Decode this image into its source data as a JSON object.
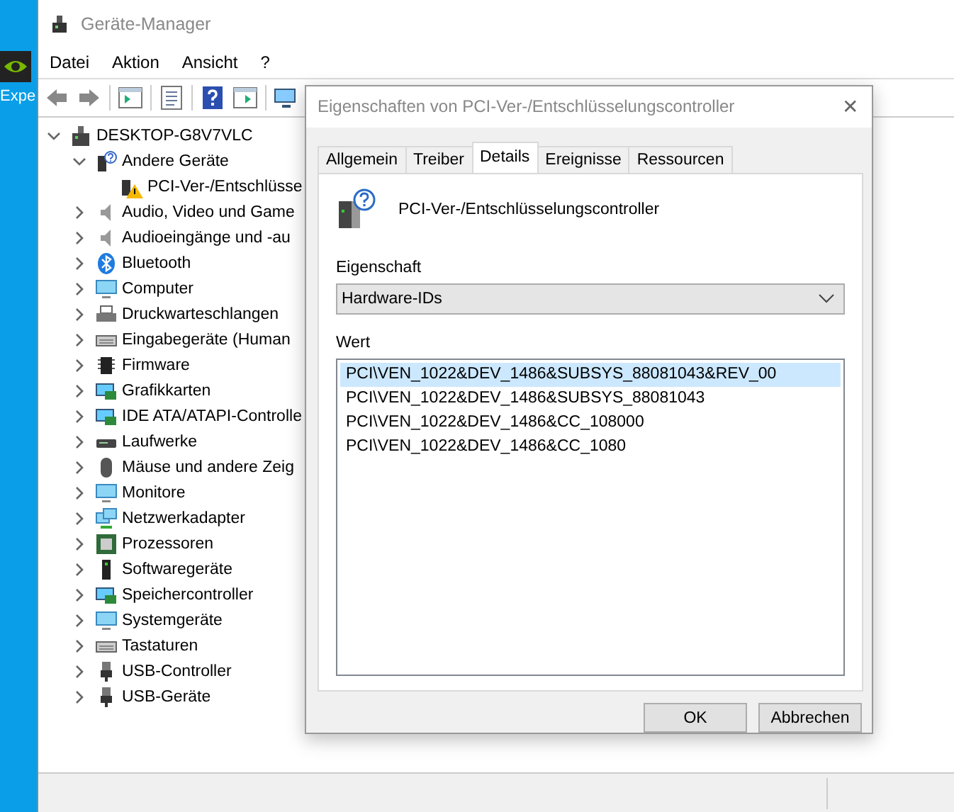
{
  "desktop": {
    "shortcut_label": "Expe"
  },
  "window": {
    "title": "Geräte-Manager"
  },
  "menu": [
    "Datei",
    "Aktion",
    "Ansicht",
    "?"
  ],
  "toolbar": [
    {
      "kind": "back"
    },
    {
      "kind": "forward"
    },
    {
      "kind": "sep"
    },
    {
      "kind": "tree"
    },
    {
      "kind": "sep"
    },
    {
      "kind": "properties"
    },
    {
      "kind": "sep"
    },
    {
      "kind": "help"
    },
    {
      "kind": "pane"
    },
    {
      "kind": "sep"
    },
    {
      "kind": "scan"
    }
  ],
  "tree": {
    "label": "DESKTOP-G8V7VLC",
    "kind": "computer",
    "expanded": true,
    "children": [
      {
        "label": "Andere Geräte",
        "kind": "unknown",
        "expanded": true,
        "children": [
          {
            "label": "PCI-Ver-/Entschlüsse",
            "kind": "warning"
          }
        ]
      },
      {
        "label": "Audio, Video und Game",
        "kind": "speaker",
        "expanded": false
      },
      {
        "label": "Audioeingänge und -au",
        "kind": "speaker",
        "expanded": false
      },
      {
        "label": "Bluetooth",
        "kind": "bluetooth",
        "expanded": false
      },
      {
        "label": "Computer",
        "kind": "monitor",
        "expanded": false
      },
      {
        "label": "Druckwarteschlangen",
        "kind": "printer",
        "expanded": false
      },
      {
        "label": "Eingabegeräte (Human",
        "kind": "keyboard",
        "expanded": false
      },
      {
        "label": "Firmware",
        "kind": "chip",
        "expanded": false
      },
      {
        "label": "Grafikkarten",
        "kind": "card",
        "expanded": false
      },
      {
        "label": "IDE ATA/ATAPI-Controlle",
        "kind": "card",
        "expanded": false
      },
      {
        "label": "Laufwerke",
        "kind": "drive",
        "expanded": false
      },
      {
        "label": "Mäuse und andere Zeig",
        "kind": "mouse",
        "expanded": false
      },
      {
        "label": "Monitore",
        "kind": "monitor",
        "expanded": false
      },
      {
        "label": "Netzwerkadapter",
        "kind": "network",
        "expanded": false
      },
      {
        "label": "Prozessoren",
        "kind": "cpu",
        "expanded": false
      },
      {
        "label": "Softwaregeräte",
        "kind": "tower",
        "expanded": false
      },
      {
        "label": "Speichercontroller",
        "kind": "card",
        "expanded": false
      },
      {
        "label": "Systemgeräte",
        "kind": "monitor",
        "expanded": false
      },
      {
        "label": "Tastaturen",
        "kind": "keyboard",
        "expanded": false
      },
      {
        "label": "USB-Controller",
        "kind": "usb",
        "expanded": false
      },
      {
        "label": "USB-Geräte",
        "kind": "usb",
        "expanded": false
      }
    ]
  },
  "dialog": {
    "title": "Eigenschaften von PCI-Ver-/Entschlüsselungscontroller",
    "close": "✕",
    "tabs": [
      {
        "label": "Allgemein",
        "selected": false
      },
      {
        "label": "Treiber",
        "selected": false
      },
      {
        "label": "Details",
        "selected": true
      },
      {
        "label": "Ereignisse",
        "selected": false
      },
      {
        "label": "Ressourcen",
        "selected": false
      }
    ],
    "device_name": "PCI-Ver-/Entschlüsselungscontroller",
    "property_label": "Eigenschaft",
    "property_value": "Hardware-IDs",
    "value_label": "Wert",
    "values": [
      {
        "text": "PCI\\VEN_1022&DEV_1486&SUBSYS_88081043&REV_00",
        "selected": true
      },
      {
        "text": "PCI\\VEN_1022&DEV_1486&SUBSYS_88081043",
        "selected": false
      },
      {
        "text": "PCI\\VEN_1022&DEV_1486&CC_108000",
        "selected": false
      },
      {
        "text": "PCI\\VEN_1022&DEV_1486&CC_1080",
        "selected": false
      }
    ],
    "buttons": [
      "OK",
      "Abbrechen"
    ]
  }
}
